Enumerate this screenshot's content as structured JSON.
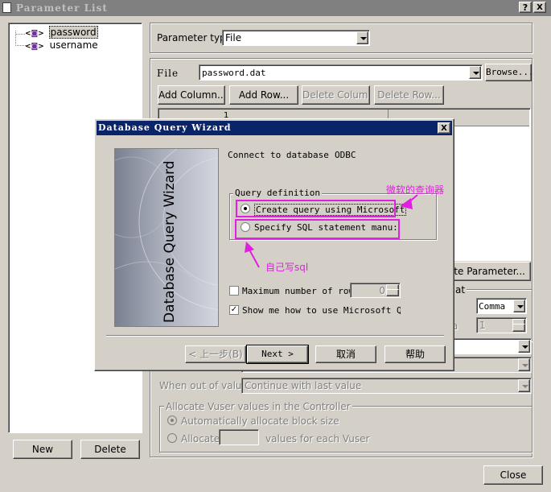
{
  "window": {
    "title": "Parameter List",
    "help_btn": "?",
    "close_btn": "X"
  },
  "tree": {
    "items": [
      {
        "label": "password",
        "selected": true
      },
      {
        "label": "username",
        "selected": false
      }
    ]
  },
  "left_buttons": {
    "new": "New",
    "delete": "Delete"
  },
  "parameter_type": {
    "label": "Parameter type:",
    "value": "File"
  },
  "file": {
    "label": "File",
    "value": "password.dat",
    "browse": "Browse..."
  },
  "table_buttons": {
    "add_column": "Add Column...",
    "add_row": "Add Row...",
    "delete_column": "Delete Column...",
    "delete_row": "Delete Row..."
  },
  "table": {
    "header_fragment": "1"
  },
  "right_panel": {
    "simulate_button": "...ulate Parameter...",
    "delimiter_group_fragment": "at",
    "delimiter_value": "Comma",
    "first_data_fragment": "a",
    "first_data_value": "1"
  },
  "out_of_values": {
    "label": "When out of values:",
    "value": "Continue with last value"
  },
  "allocate": {
    "group_title": "Allocate Vuser values in the Controller",
    "auto_option": "Automatically allocate block size",
    "manual_option": "Allocate",
    "manual_suffix": "values for each Vuser"
  },
  "close_button": "Close",
  "wizard": {
    "title": "Database Query Wizard",
    "close_btn": "X",
    "side_text": "Database Query Wizard",
    "connect_label": "Connect to database",
    "connect_value": "ODBC",
    "query_group": "Query definition",
    "option_create": "Create query using Microsoft",
    "option_specify": "Specify SQL statement manu:",
    "max_rows_label": "Maximum number of row",
    "max_rows_value": "0",
    "show_me_label": "Show me how to use Microsoft Quer",
    "btn_back": "< 上一步(B)",
    "btn_next": "Next >",
    "btn_cancel": "取消",
    "btn_help": "帮助"
  },
  "annotations": {
    "microsoft_query": "微软的查询器",
    "write_sql": "自己写sql"
  },
  "colors": {
    "annotation": "#e020e0",
    "title_active": "#0a246a",
    "title_inactive": "#808080"
  }
}
